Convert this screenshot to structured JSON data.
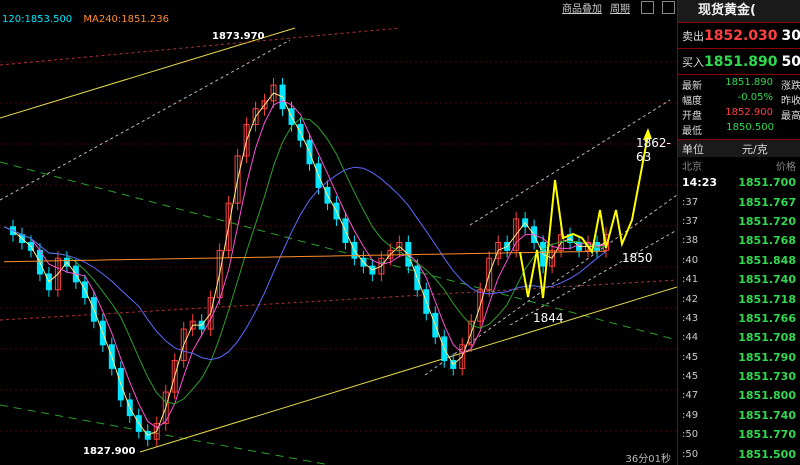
{
  "legend": {
    "ma120": "120:1853.500",
    "ma240": "MA240:1851.236"
  },
  "top_links": {
    "overlay": "商品叠加",
    "period": "周期"
  },
  "high_label": "1873.970",
  "low_label": "1827.900",
  "annotations": {
    "target": "1862-63",
    "support_1850": "1850",
    "support_1844": "1844"
  },
  "timer": "36分01秒",
  "colors": {
    "up": "#ff4040",
    "down": "#2fd94f",
    "cyan": "#00e5ff",
    "yellow": "#ffff00",
    "grid": "#8b0000"
  },
  "chart_data": {
    "type": "line",
    "ylim": [
      1826,
      1880
    ],
    "high": 1873.97,
    "low": 1827.9,
    "series": [
      {
        "name": "120",
        "value": 1853.5
      },
      {
        "name": "MA240",
        "value": 1851.236
      }
    ],
    "price": [
      1855,
      1854,
      1853,
      1852,
      1849,
      1847,
      1851,
      1850,
      1848,
      1846,
      1843,
      1840,
      1837,
      1833,
      1831,
      1829,
      1828,
      1830,
      1834,
      1838,
      1842,
      1843,
      1842,
      1846,
      1852,
      1858,
      1864,
      1868,
      1870,
      1871,
      1873,
      1870,
      1868,
      1866,
      1863,
      1860,
      1858,
      1856,
      1853,
      1851,
      1850,
      1849,
      1851,
      1852,
      1853,
      1850,
      1847,
      1844,
      1841,
      1838,
      1837,
      1840,
      1843,
      1847,
      1851,
      1853,
      1852,
      1856,
      1855,
      1853,
      1850,
      1852,
      1854,
      1853,
      1852,
      1853,
      1852,
      1854
    ]
  },
  "panel": {
    "title": "现货黄金(",
    "sell": {
      "label": "卖出",
      "value": "1852.030",
      "extra": "30"
    },
    "buy": {
      "label": "买入",
      "value": "1851.890",
      "extra": "50"
    },
    "stats": [
      {
        "label": "最新",
        "value": "1851.890",
        "extra": "涨跌",
        "color": "green"
      },
      {
        "label": "幅度",
        "value": "-0.05%",
        "extra": "昨收",
        "color": "green"
      },
      {
        "label": "开盘",
        "value": "1852.900",
        "extra": "最高",
        "color": "red"
      },
      {
        "label": "最低",
        "value": "1850.500",
        "extra": "",
        "color": "green"
      }
    ],
    "unit_label": "单位",
    "unit_value": "元/克",
    "ticks_header": {
      "left": "北京",
      "right": "价格"
    },
    "ticks": [
      {
        "time": "14:23",
        "price": "1851.700"
      },
      {
        "time": ":37",
        "price": "1851.767"
      },
      {
        "time": ":37",
        "price": "1851.720"
      },
      {
        "time": ":38",
        "price": "1851.768"
      },
      {
        "time": ":40",
        "price": "1851.848"
      },
      {
        "time": ":41",
        "price": "1851.740"
      },
      {
        "time": ":42",
        "price": "1851.718"
      },
      {
        "time": ":43",
        "price": "1851.766"
      },
      {
        "time": ":44",
        "price": "1851.708"
      },
      {
        "time": ":45",
        "price": "1851.790"
      },
      {
        "time": ":45",
        "price": "1851.730"
      },
      {
        "time": ":47",
        "price": "1851.800"
      },
      {
        "time": ":49",
        "price": "1851.740"
      },
      {
        "time": ":50",
        "price": "1851.770"
      },
      {
        "time": ":50",
        "price": "1851.500"
      }
    ]
  }
}
